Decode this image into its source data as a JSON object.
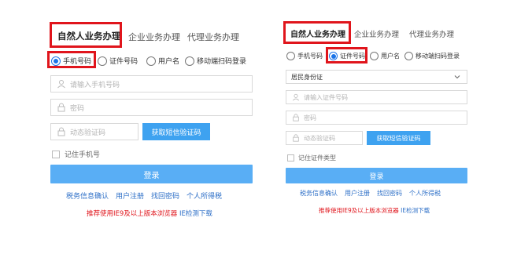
{
  "left": {
    "tabs": [
      "自然人业务办理",
      "企业业务办理",
      "代理业务办理"
    ],
    "radios": [
      "手机号码",
      "证件号码",
      "用户名",
      "移动端扫码登录"
    ],
    "phone_placeholder": "请输入手机号码",
    "password_placeholder": "密码",
    "code_placeholder": "动态验证码",
    "get_code_label": "获取短信验证码",
    "remember_label": "记住手机号",
    "login_label": "登录",
    "links": [
      "税务信息确认",
      "用户注册",
      "找回密码",
      "个人所得税"
    ],
    "notice_red": "推荐使用IE9及以上版本浏览器",
    "notice_blue": "IE检测下载"
  },
  "right": {
    "tabs": [
      "自然人业务办理",
      "企业业务办理",
      "代理业务办理"
    ],
    "radios": [
      "手机号码",
      "证件号码",
      "用户名",
      "移动端扫码登录"
    ],
    "id_type_value": "居民身份证",
    "id_placeholder": "请输入证件号码",
    "password_placeholder": "密码",
    "code_placeholder": "动态验证码",
    "get_code_label": "获取短信验证码",
    "remember_label": "记住证件类型",
    "login_label": "登录",
    "links": [
      "税务信息确认",
      "用户注册",
      "找回密码",
      "个人所得税"
    ],
    "notice_red": "推荐使用IE9及以上版本浏览器",
    "notice_blue": "IE检测下载"
  },
  "colors": {
    "highlight": "#e0151c",
    "accent": "#1a73e8",
    "button": "#59aef5",
    "link": "#2d6fc7"
  },
  "icons": [
    "user-icon",
    "lock-icon",
    "chevron-down-icon"
  ]
}
